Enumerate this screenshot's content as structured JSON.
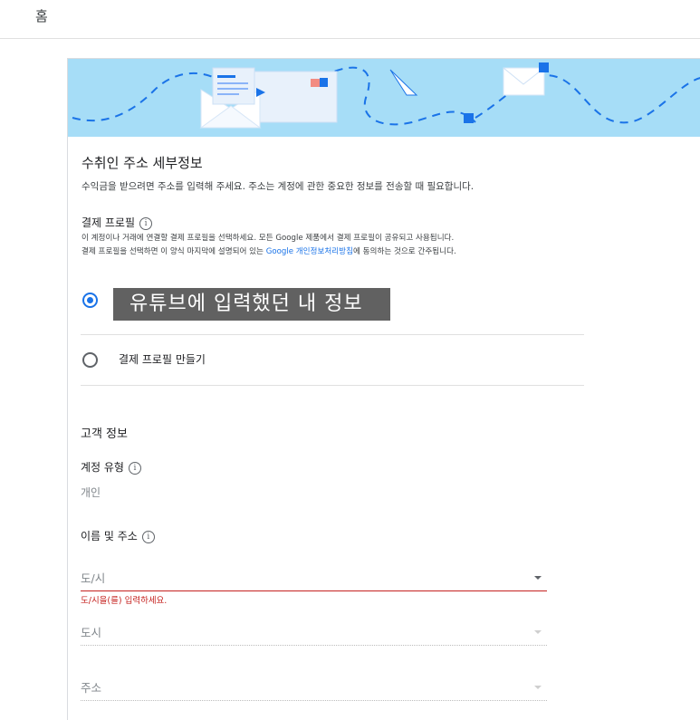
{
  "header": {
    "home": "홈"
  },
  "section": {
    "title": "수취인 주소 세부정보",
    "description": "수익금을 받으려면 주소를 입력해 주세요. 주소는 계정에 관한 중요한 정보를 전송할 때 필요합니다."
  },
  "payment_profile": {
    "label": "결제 프로필",
    "note1": "이 계정이나 거래에 연결할 결제 프로필을 선택하세요. 모든 Google 제품에서 결제 프로필이 공유되고 사용됩니다.",
    "note2_pre": "결제 프로필을 선택하면 이 양식 마지막에 설명되어 있는 ",
    "note2_link": "Google 개인정보처리방침",
    "note2_post": "에 동의하는 것으로 간주됩니다.",
    "options": [
      {
        "label": "유튜브에 입력했던 내 정보",
        "selected": true
      },
      {
        "label": "결제 프로필 만들기",
        "selected": false
      }
    ]
  },
  "customer": {
    "title": "고객 정보",
    "account_type_label": "계정 유형",
    "account_type_value": "개인",
    "name_address_label": "이름 및 주소"
  },
  "fields": {
    "province": {
      "placeholder": "도/시",
      "error": "도/시을(를) 입력하세요."
    },
    "city": {
      "placeholder": "도시"
    },
    "address": {
      "placeholder": "주소"
    }
  },
  "icons": {
    "info": "info-icon",
    "dropdown": "caret-down-icon",
    "banner": "mail-envelope-illustration"
  },
  "colors": {
    "banner": "#a6ddf7",
    "accent": "#1a73e8",
    "error": "#c5221f",
    "redaction": "#616161"
  }
}
